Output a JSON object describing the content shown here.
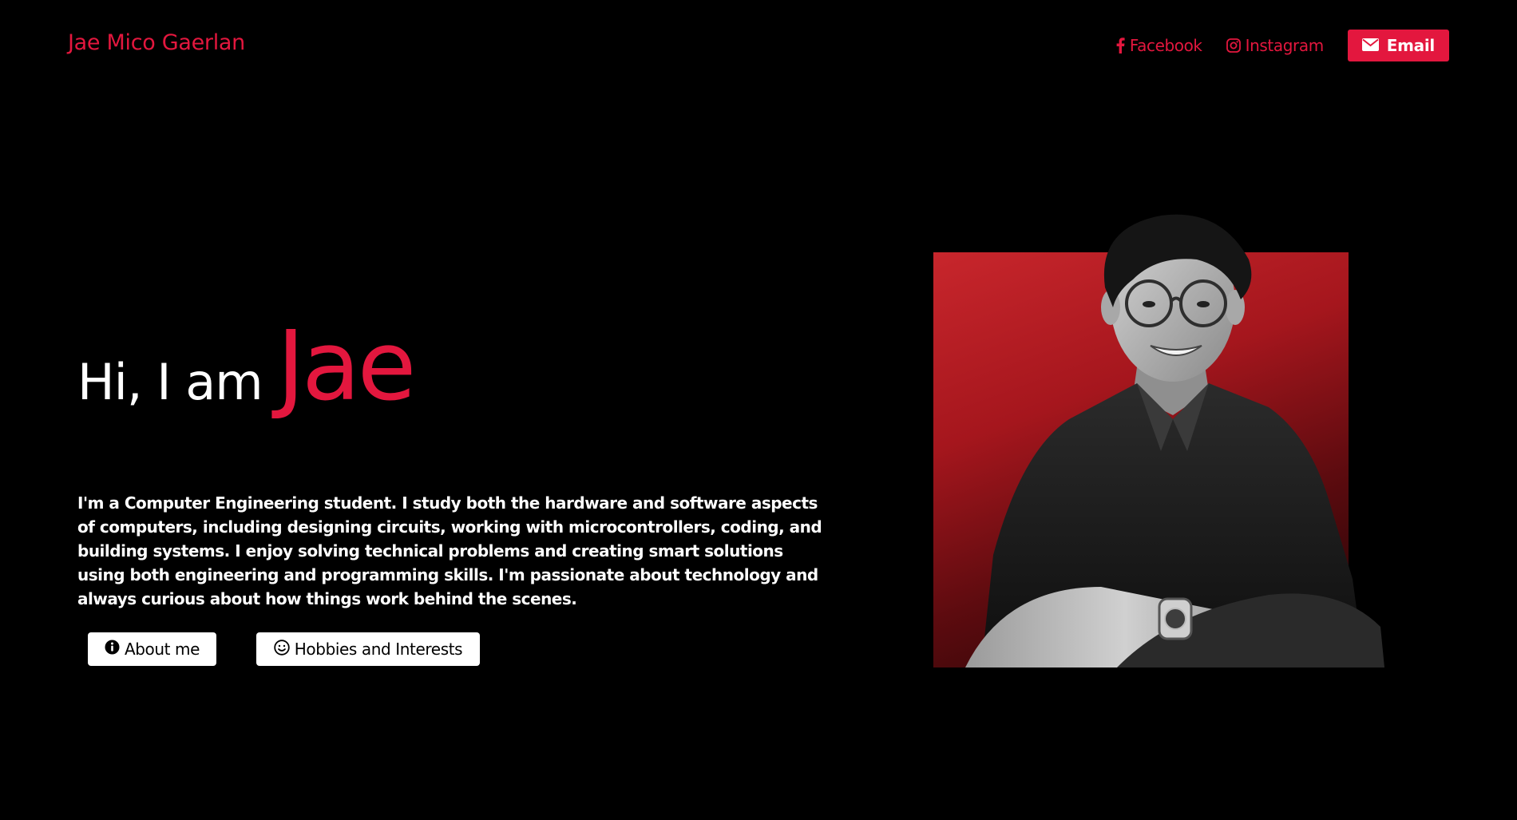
{
  "header": {
    "brand": "Jae Mico Gaerlan",
    "nav": {
      "facebook": {
        "label": "Facebook",
        "icon": "facebook-icon"
      },
      "instagram": {
        "label": "Instagram",
        "icon": "instagram-icon"
      },
      "email": {
        "label": "Email",
        "icon": "envelope-icon"
      }
    }
  },
  "hero": {
    "greeting": "Hi, I am",
    "name": "Jae",
    "bio": "I'm a Computer Engineering student. I study both the hardware and software aspects of computers, including designing circuits, working with microcontrollers, coding, and building systems. I enjoy solving technical problems and creating smart solutions using both engineering and programming skills. I'm passionate about technology and always curious about how things work behind the scenes.",
    "buttons": {
      "about": {
        "label": "About me",
        "icon": "info-icon"
      },
      "hobbies": {
        "label": "Hobbies and Interests",
        "icon": "smile-icon"
      }
    }
  },
  "colors": {
    "accent": "#e3173e",
    "background": "#000000",
    "text": "#ffffff"
  }
}
